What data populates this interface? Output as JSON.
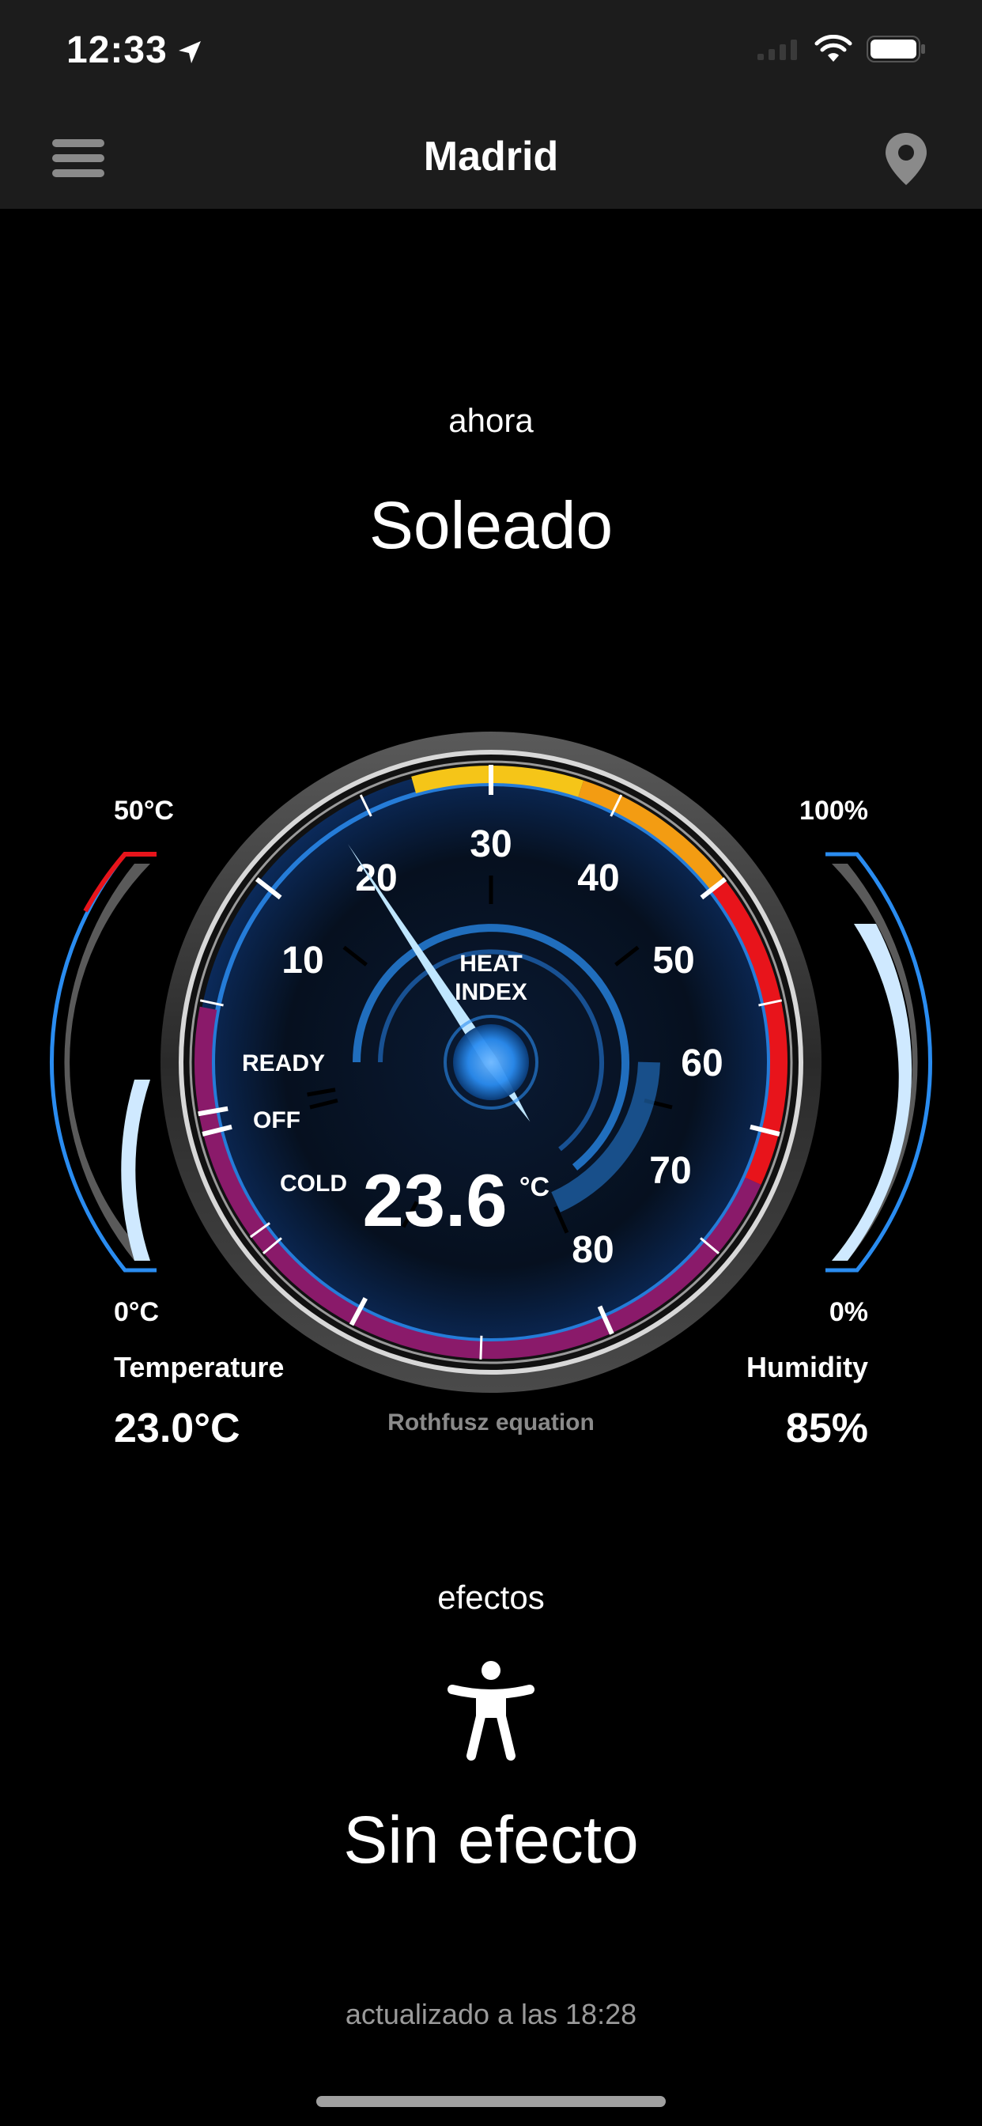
{
  "status": {
    "time": "12:33"
  },
  "nav": {
    "title": "Madrid",
    "menu_icon": "hamburger-icon",
    "location_icon": "location-pin-icon"
  },
  "current": {
    "label": "ahora",
    "condition": "Soleado"
  },
  "gauge": {
    "heat_index": "23.6",
    "unit": "°C",
    "caption_line1": "HEAT",
    "caption_line2": "INDEX",
    "scale_labels": [
      "10",
      "20",
      "30",
      "40",
      "50",
      "60",
      "70",
      "80"
    ],
    "state_ready": "READY",
    "state_off": "OFF",
    "state_cold": "COLD",
    "needle_value": 23.6,
    "equation": "Rothfusz equation"
  },
  "temperature": {
    "max_label": "50°C",
    "min_label": "0°C",
    "title": "Temperature",
    "value": "23.0°C",
    "fill_fraction": 0.46
  },
  "humidity": {
    "max_label": "100%",
    "min_label": "0%",
    "title": "Humidity",
    "value": "85%",
    "fill_fraction": 0.85
  },
  "effects": {
    "label": "efectos",
    "icon": "person-standing-icon",
    "value": "Sin efecto"
  },
  "footer": {
    "updated": "actualizado a las 18:28"
  },
  "colors": {
    "accent_blue": "#2a8cf0",
    "red": "#e8141b",
    "orange": "#f39c12",
    "yellow": "#f5c518",
    "magenta": "#8a1a6a"
  }
}
